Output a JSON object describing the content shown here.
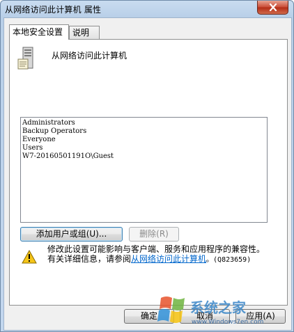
{
  "window": {
    "title": "从网络访问此计算机 属性"
  },
  "tabs": [
    {
      "label": "本地安全设置"
    },
    {
      "label": "说明"
    }
  ],
  "policy": {
    "name": "从网络访问此计算机"
  },
  "accounts": [
    "Administrators",
    "Backup Operators",
    "Everyone",
    "Users",
    "W7-20160501191O\\Guest"
  ],
  "buttons": {
    "add": "添加用户或组(U)...",
    "remove": "删除(R)",
    "ok": "确定",
    "cancel": "取消",
    "apply": "应用(A)"
  },
  "warning": {
    "line1": "修改此设置可能影响与客户端、服务和应用程序的兼容性。",
    "line2_prefix": "有关详细信息，请参阅",
    "link": "从网络访问此计算机",
    "line2_suffix": "。(Q823659)"
  },
  "watermark": {
    "brand": "系统之家",
    "url": "www.Windows7en.com"
  },
  "colors": {
    "title_bar": "#b8cfe8",
    "close_button": "#c94a34",
    "link": "#0066cc",
    "focus_border": "#3c7fb1"
  },
  "icons": {
    "close": "close-icon",
    "policy": "server-icon",
    "warning": "warning-icon"
  }
}
